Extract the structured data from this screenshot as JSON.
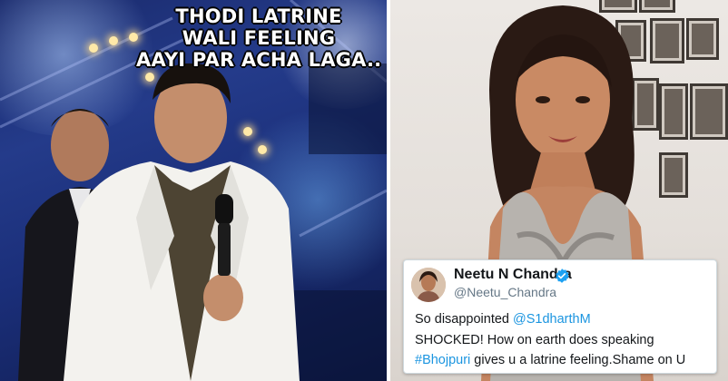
{
  "meme": {
    "caption_lines": [
      "THODI LATRINE",
      "WALI FEELING",
      "AAYI PAR ACHA LAGA.."
    ]
  },
  "tweet": {
    "name": "Neetu N Chandra",
    "handle": "@Neetu_Chandra",
    "line1_text": "So disappointed ",
    "line1_mention": "@S1dharthM",
    "line2_text": "SHOCKED! How on earth does speaking",
    "line3_hashtag": "#Bhojpuri",
    "line3_text": " gives u a latrine feeling.Shame on U",
    "verified_icon": "verified-badge",
    "accent_color": "#1da1f2"
  }
}
